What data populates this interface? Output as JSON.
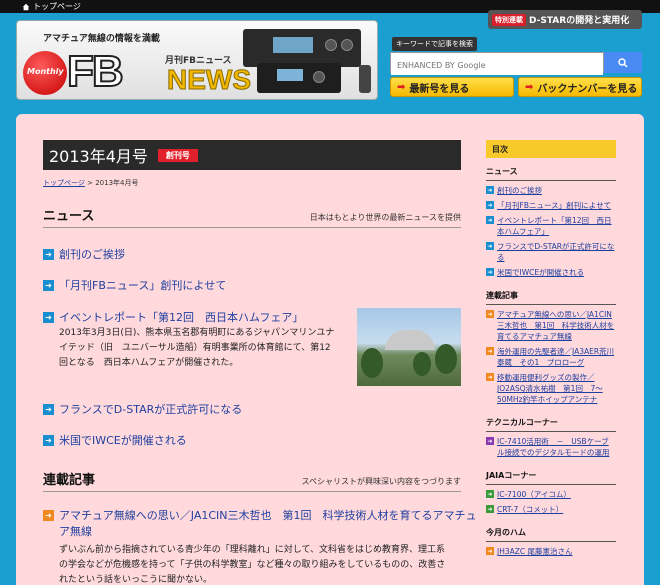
{
  "topbar": {
    "home_label": "トップページ"
  },
  "header": {
    "tagline": "アマチュア無線の情報を満載",
    "logo_monthly": "Monthly",
    "logo_fb": "FB",
    "logo_sub": "月刊FBニュース",
    "logo_news": "NEWS",
    "special_tag": "特別連載",
    "special_text": "D-STARの開発と実用化",
    "search_label": "キーワードで記事を検索",
    "search_placeholder": "ENHANCED BY Google",
    "latest_btn": "最新号を見る",
    "backnumber_btn": "バックナンバーを見る"
  },
  "issue": {
    "title": "2013年4月号",
    "badge": "創刊号"
  },
  "breadcrumb": {
    "home": "トップページ",
    "sep": " > ",
    "current": "2013年4月号"
  },
  "news": {
    "title": "ニュース",
    "desc": "日本はもとより世界の最新ニュースを提供",
    "items": [
      "創刊のご挨拶",
      "「月刊FBニュース」創刊によせて",
      "イベントレポート「第12回　西日本ハムフェア」",
      "フランスでD-STARが正式許可になる",
      "米国でIWCEが開催される"
    ],
    "excerpt_lines": [
      "2013年3月3日(日)、熊本県玉名郡有明町にあるジャパンマリンユナ",
      "イテッド（旧　ユニバーサル造船）有明事業所の体育館にて、第12",
      "回となる　西日本ハムフェアが開催された。"
    ]
  },
  "serial": {
    "title": "連載記事",
    "desc": "スペシャリストが興味深い内容をつづります",
    "item_line1": "アマチュア無線への思い／JA1CIN三木哲也　第1回　科学技術人材を育てるアマチュ",
    "item_line2": "ア無線",
    "excerpt_lines": [
      "ずいぶん前から指摘されている青少年の「理科離れ」に対して、文科省をはじめ教育界、理工系",
      "の学会などが危機感を持って「子供の科学教室」など種々の取り組みをしているものの、改善さ",
      "れたという話をいっこうに聞かない。"
    ]
  },
  "sidebar": {
    "heading": "目次",
    "cat_news": "ニュース",
    "news_items": [
      "創刊のご挨拶",
      "「月刊FBニュース」創刊によせて",
      "イベントレポート「第12回　西日本ハムフェア」",
      "フランスでD-STARが正式許可になる",
      "米国でIWCEが開催される"
    ],
    "cat_serial": "連載記事",
    "serial_items": [
      "アマチュア無線への思い／JA1CIN三木哲也　第1回　科学技術人材を育てるアマチュア無線",
      "海外運用の先駆者達／JA3AER荒川泰蔵　その1　プロローグ",
      "移動運用便利グッズの製作／JO2ASQ清水祐樹　第1回　7～50MHz釣竿ホイップアンテナ"
    ],
    "cat_tech": "テクニカルコーナー",
    "tech_items": [
      "IC-7410活用術　－　USBケーブル接続でのデジタルモードの運用"
    ],
    "cat_jaia": "JAIAコーナー",
    "jaia_items": [
      "IC-7100（アイコム）",
      "CRT-7（コメット）"
    ],
    "cat_ham": "今月のハム",
    "ham_items": [
      "JH3AZC 尾藤憲治さん"
    ]
  }
}
